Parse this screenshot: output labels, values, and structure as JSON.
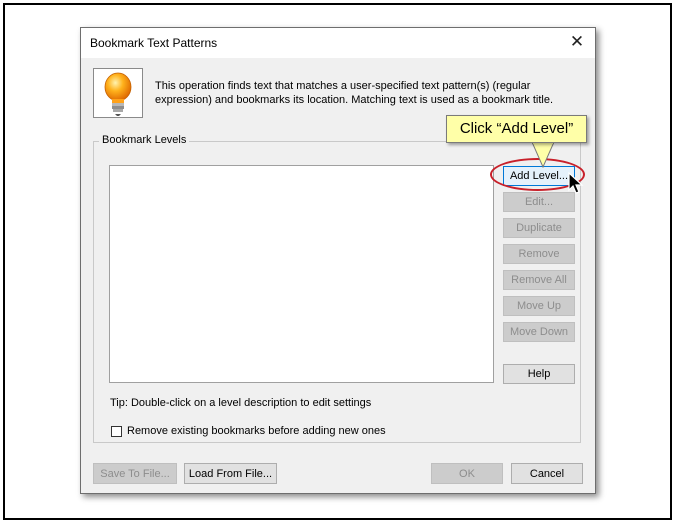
{
  "dialog": {
    "title": "Bookmark Text Patterns",
    "description": "This operation finds text that matches a user-specified text pattern(s) (regular expression) and bookmarks its location. Matching text is used as a bookmark title.",
    "group_label": "Bookmark Levels",
    "side_buttons": {
      "add_level": "Add Level...",
      "edit": "Edit...",
      "duplicate": "Duplicate",
      "remove": "Remove",
      "remove_all": "Remove All",
      "move_up": "Move Up",
      "move_down": "Move Down",
      "help": "Help"
    },
    "tip": "Tip: Double-click on a level description to edit settings",
    "checkbox_label": "Remove existing bookmarks before adding new ones",
    "checkbox_checked": false,
    "bottom_buttons": {
      "save_to_file": "Save To File...",
      "load_from_file": "Load From File...",
      "ok": "OK",
      "cancel": "Cancel"
    }
  },
  "annotation": {
    "callout_text": "Click “Add  Level”",
    "callout_color": "#ffffa8",
    "ring_color": "#c8202a"
  }
}
